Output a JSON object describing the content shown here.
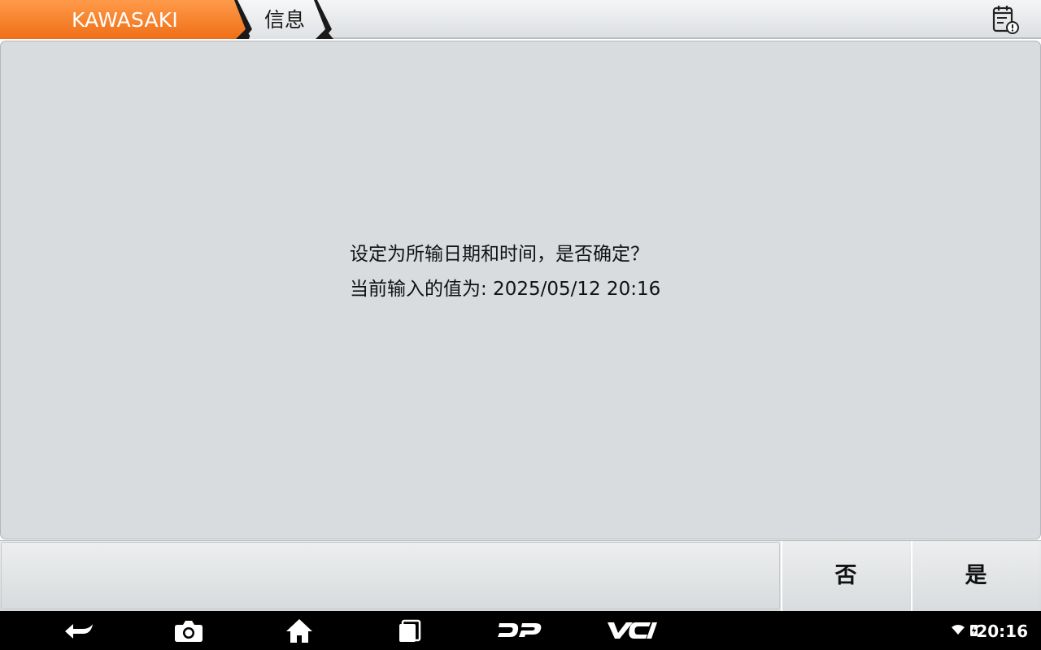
{
  "header": {
    "brand_tab": "KAWASAKI",
    "info_tab": "信息",
    "log_icon": "calendar-alert-icon",
    "accent_color": "#f47b20"
  },
  "dialog": {
    "line1": "设定为所输日期和时间，是否确定？",
    "line2": "当前输入的值为: 2025/05/12 20:16"
  },
  "actions": {
    "no_label": "否",
    "yes_label": "是"
  },
  "navbar": {
    "items": [
      "back-icon",
      "camera-icon",
      "home-icon",
      "recent-apps-icon",
      "dp-logo",
      "vci-logo"
    ],
    "dp_label": "DP",
    "vci_label": "VCI",
    "clock": "20:16"
  }
}
